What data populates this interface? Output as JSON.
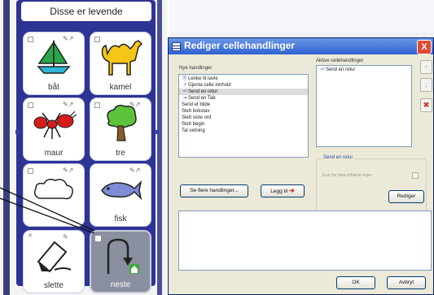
{
  "grid": {
    "sentence": "Disse  er  levende",
    "cells": [
      {
        "label": "båt"
      },
      {
        "label": "kamel"
      },
      {
        "label": "maur"
      },
      {
        "label": "tre"
      },
      {
        "label": "fisk"
      },
      {
        "label": "slette"
      },
      {
        "label": "neste"
      }
    ]
  },
  "dialog": {
    "title": "Rediger cellehandlinger",
    "close_label": "X",
    "available_label": "Nye handlinger",
    "available_actions": [
      {
        "label": "Lenke til tavle",
        "icon": "link-icon"
      },
      {
        "label": "Gjenta celle innhold",
        "icon": "repeat-icon"
      },
      {
        "label": "Send en retur",
        "icon": "return-icon",
        "selected": true
      },
      {
        "label": "Send en Tab",
        "icon": "tab-icon"
      },
      {
        "label": "Send et bilde",
        "icon": ""
      },
      {
        "label": "Slett bokstav",
        "icon": ""
      },
      {
        "label": "Slett siste ord",
        "icon": ""
      },
      {
        "label": "Slett begin",
        "icon": ""
      },
      {
        "label": "Tal setning",
        "icon": ""
      }
    ],
    "current_label": "Aktive cellehandlinger",
    "current_actions": [
      {
        "label": "Send en retur",
        "icon": "return-icon"
      }
    ],
    "side_buttons": {
      "up": "↑",
      "down": "↓",
      "delete": "✖"
    },
    "more_actions_button": "Se flere handlinger...",
    "add_button": "Legg til",
    "add_arrow": "➔",
    "options_group_title": "Send en retur",
    "options_text": "Kun for ikke-tilhørte linjer",
    "edit_button": "Rediger",
    "ok_button": "OK",
    "cancel_button": "Avbryt"
  }
}
